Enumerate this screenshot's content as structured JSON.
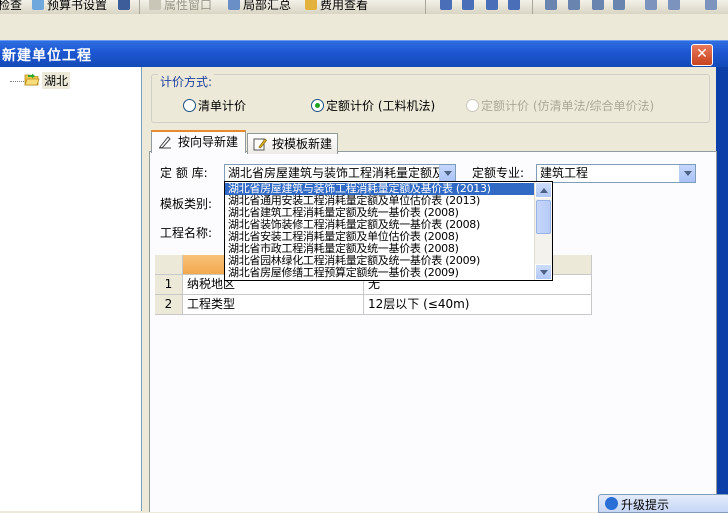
{
  "toolbar": {
    "items": [
      "检查",
      "预算书设置",
      "属性窗口",
      "局部汇总",
      "费用查看"
    ]
  },
  "window": {
    "title": "新建单位工程",
    "close_icon": "close-icon"
  },
  "tree": {
    "root_label": "湖北",
    "root_icon": "folder-open-icon"
  },
  "pricing": {
    "legend": "计价方式:",
    "options": [
      {
        "label": "清单计价",
        "checked": false,
        "enabled": true
      },
      {
        "label": "定额计价 (工料机法)",
        "checked": true,
        "enabled": true
      },
      {
        "label": "定额计价 (仿清单法/综合单价法)",
        "checked": false,
        "enabled": false
      }
    ]
  },
  "tabs": [
    {
      "label": "按向导新建",
      "active": true,
      "icon": "wizard-icon"
    },
    {
      "label": "按模板新建",
      "active": false,
      "icon": "template-icon"
    }
  ],
  "form": {
    "quota_library_label": "定 额 库:",
    "quota_library_value": "湖北省房屋建筑与装饰工程消耗量定额及",
    "quota_specialty_label": "定额专业:",
    "quota_specialty_value": "建筑工程",
    "template_category_label": "模板类别:",
    "project_name_label": "工程名称:"
  },
  "dropdown": {
    "items": [
      "湖北省房屋建筑与装饰工程消耗量定额及基价表 (2013)",
      "湖北省通用安装工程消耗量定额及单位估价表 (2013)",
      "湖北省建筑工程消耗量定额及统一基价表 (2008)",
      "湖北省装饰装修工程消耗量定额及统一基价表 (2008)",
      "湖北省安装工程消耗量定额及单位估价表 (2008)",
      "湖北省市政工程消耗量定额及统一基价表 (2008)",
      "湖北省园林绿化工程消耗量定额及统一基价表 (2009)",
      "湖北省房屋修缮工程预算定额统一基价表 (2009)"
    ],
    "selected_index": 0
  },
  "grid": {
    "rows": [
      {
        "num": "1",
        "name": "纳税地区",
        "value": "无"
      },
      {
        "num": "2",
        "name": "工程类型",
        "value": "12层以下 (≤40m)"
      }
    ]
  },
  "status": {
    "upgrade_label": "升级提示"
  },
  "colors": {
    "title_bar": "#1d56d1",
    "selection": "#316ac5",
    "dialog_bg": "#ece9d8",
    "group_legend": "#1f3fa0"
  }
}
